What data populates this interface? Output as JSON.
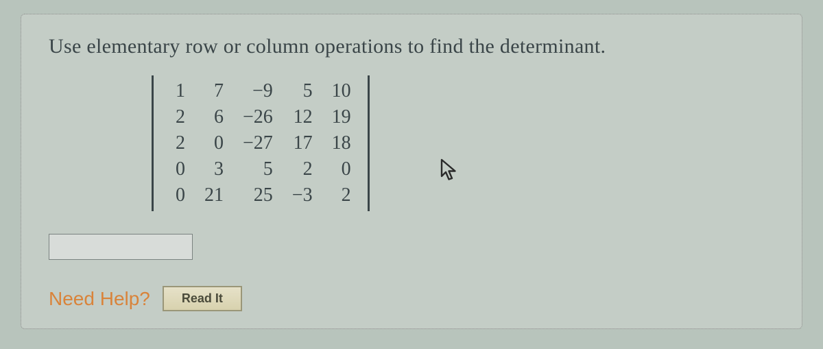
{
  "prompt": "Use elementary row or column operations to find the determinant.",
  "matrix": {
    "rows": [
      [
        "1",
        "7",
        "−9",
        "5",
        "10"
      ],
      [
        "2",
        "6",
        "−26",
        "12",
        "19"
      ],
      [
        "2",
        "0",
        "−27",
        "17",
        "18"
      ],
      [
        "0",
        "3",
        "5",
        "2",
        "0"
      ],
      [
        "0",
        "21",
        "25",
        "−3",
        "2"
      ]
    ]
  },
  "answer_value": "",
  "help": {
    "label": "Need Help?",
    "read_label": "Read It"
  }
}
